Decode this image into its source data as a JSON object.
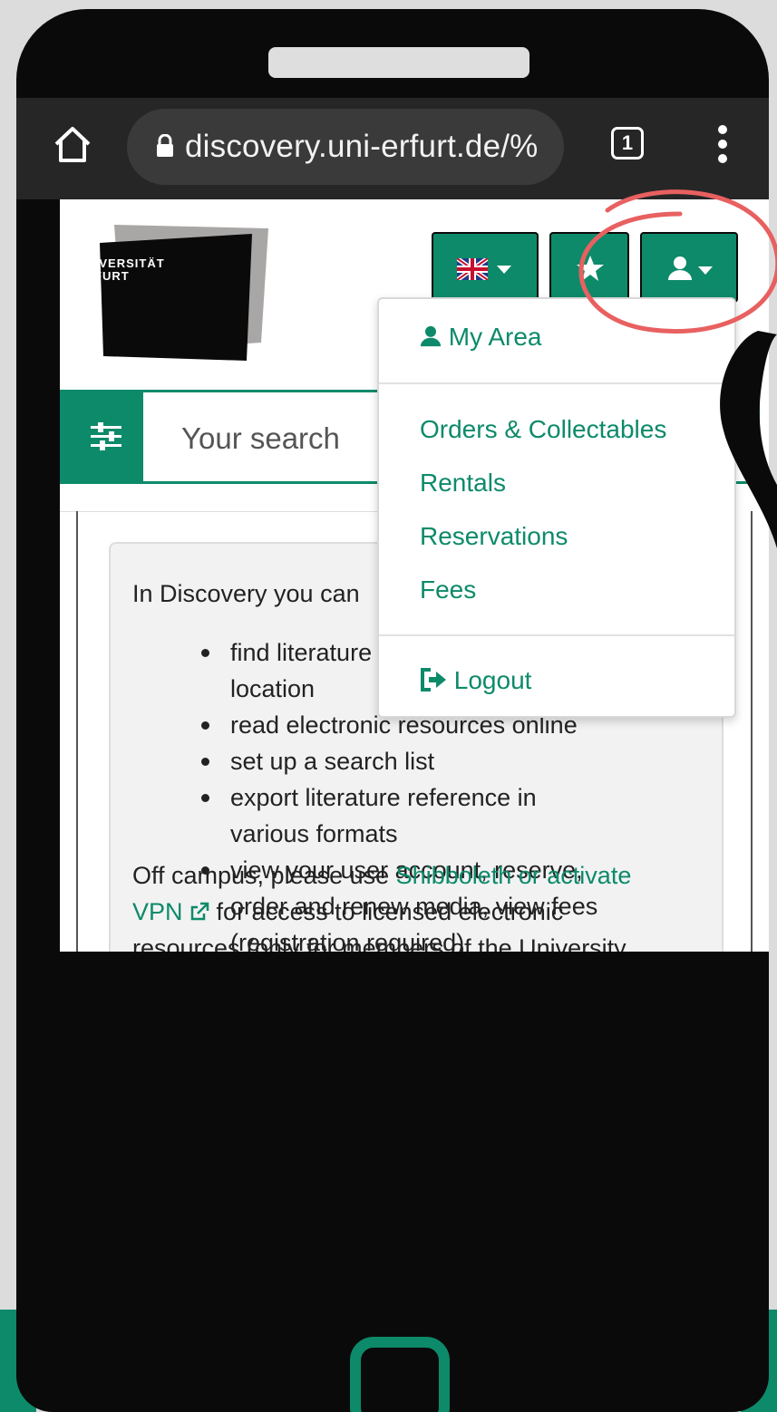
{
  "browser": {
    "url": "discovery.uni-erfurt.de/%",
    "tab_count": "1"
  },
  "logo": {
    "line1": "UNIVERSITÄT",
    "line2": "ERFURT"
  },
  "search": {
    "placeholder": "Your search"
  },
  "dropdown": {
    "my_area": "My Area",
    "items": [
      "Orders & Collectables",
      "Rentals",
      "Reservations",
      "Fees"
    ],
    "logout": "Logout"
  },
  "info": {
    "intro": "In Discovery you can",
    "features": [
      "find literature and find out their location",
      "read electronic resources online",
      "set up a search list",
      "export literature reference in various formats",
      "view your user account, reserve, order and renew media, view fees (registration required)"
    ],
    "offcampus_prefix": "Off campus, please use ",
    "offcampus_link": "Shibboleth or activate VPN",
    "offcampus_suffix": " for access to licensed electronic resources (only for members of the University of Erfurt)."
  },
  "colors": {
    "accent": "#0d8a6a",
    "annotation_red": "#e86060",
    "background": "#dcdcdc"
  }
}
